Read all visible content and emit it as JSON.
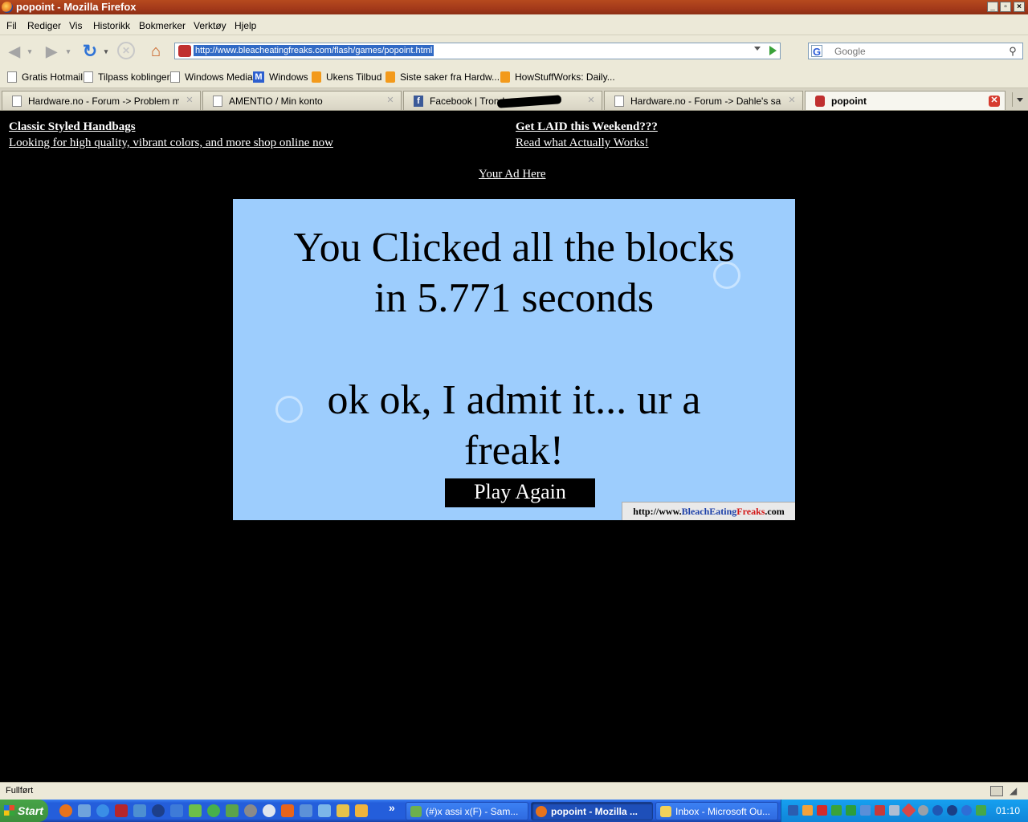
{
  "window": {
    "title": "popoint - Mozilla Firefox"
  },
  "menu": [
    {
      "label": "Fil",
      "key": "F"
    },
    {
      "label": "Rediger",
      "key": "R"
    },
    {
      "label": "Vis",
      "key": "V"
    },
    {
      "label": "Historikk",
      "key": "s"
    },
    {
      "label": "Bokmerker",
      "key": "B"
    },
    {
      "label": "Verktøy",
      "key": "k"
    },
    {
      "label": "Hjelp",
      "key": "H"
    }
  ],
  "nav": {
    "url": "http://www.bleacheatingfreaks.com/flash/games/popoint.html",
    "search_placeholder": "Google"
  },
  "bookmarks": [
    {
      "label": "Gratis Hotmail",
      "icon": "page-icon"
    },
    {
      "label": "Tilpass koblinger",
      "icon": "page-icon"
    },
    {
      "label": "Windows Media",
      "icon": "page-icon"
    },
    {
      "label": "Windows",
      "icon": "msn-icon"
    },
    {
      "label": "Ukens Tilbud",
      "icon": "rss-icon"
    },
    {
      "label": "Siste saker fra Hardw...",
      "icon": "rss-icon"
    },
    {
      "label": "HowStuffWorks: Daily...",
      "icon": "rss-icon"
    }
  ],
  "tabs": [
    {
      "label": "Hardware.no - Forum -> Problem med v...",
      "icon": "page-icon",
      "active": false
    },
    {
      "label": "AMENTIO / Min konto",
      "icon": "page-icon",
      "active": false
    },
    {
      "label": "Facebook | Trond",
      "icon": "facebook-icon",
      "active": false
    },
    {
      "label": "Hardware.no - Forum -> Dahle's samling...",
      "icon": "page-icon",
      "active": false
    },
    {
      "label": "popoint",
      "icon": "popoint-icon",
      "active": true
    }
  ],
  "ads": {
    "left": {
      "title": "Classic Styled Handbags",
      "text": "Looking for high quality, vibrant colors, and more shop online now"
    },
    "right": {
      "title": "Get LAID this Weekend???",
      "text": "Read what Actually Works!"
    },
    "center": "Your Ad Here"
  },
  "game": {
    "line1": "You Clicked all the blocks",
    "line2": "in 5.771 seconds",
    "line3": "ok ok, I admit it... ur a",
    "line4": "freak!",
    "play_again": "Play Again",
    "link_prefix": "http://www.",
    "link_bleach": "Bleach",
    "link_eating": "Eating",
    "link_freaks": "Freaks",
    "link_suffix": ".com",
    "background_color": "#9dcdfd"
  },
  "status": {
    "text": "Fullført"
  },
  "taskbar": {
    "start_label": "Start",
    "chevron": "»",
    "tasks": [
      {
        "label": "(#)x assi x(F) - Sam...",
        "active": false
      },
      {
        "label": "popoint - Mozilla ...",
        "active": true
      },
      {
        "label": "Inbox - Microsoft Ou...",
        "active": false
      }
    ],
    "clock": "01:10"
  }
}
